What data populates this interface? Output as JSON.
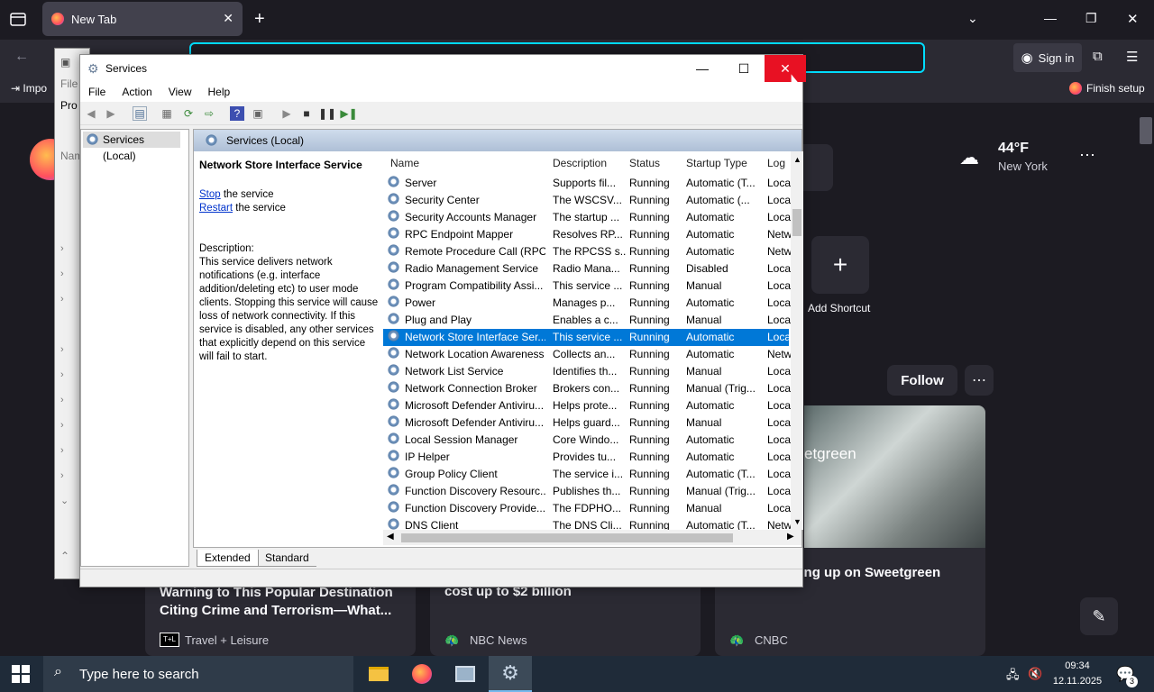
{
  "browser": {
    "tab_title": "New Tab",
    "bookmarks_import": "Impo",
    "sign_in": "Sign in",
    "finish_setup": "Finish setup",
    "weather": {
      "temp": "44°F",
      "city": "New York"
    },
    "shortcut_label": "Add Shortcut",
    "follow_label": "Follow",
    "news": [
      {
        "headline": "Warning to This Popular Destination Citing Crime and Terrorism—What...",
        "source": "Travel + Leisure"
      },
      {
        "headline": "cost up to $2 billion",
        "source": "NBC News"
      },
      {
        "headline": "ans are giving up on Sweetgreen",
        "source": "CNBC"
      }
    ],
    "photo_sign": "etgreen"
  },
  "back_window": {
    "menu_file": "File",
    "menu_pro": "Pro",
    "label_nam": "Nam"
  },
  "services": {
    "title": "Services",
    "menu": [
      "File",
      "Action",
      "View",
      "Help"
    ],
    "tree_item": "Services (Local)",
    "pane_title": "Services (Local)",
    "selected_name": "Network Store Interface Service",
    "stop_link": "Stop",
    "stop_rest": " the service",
    "restart_link": "Restart",
    "restart_rest": " the service",
    "desc_label": "Description:",
    "desc_text": "This service delivers network notifications (e.g. interface addition/deleting etc) to user mode clients. Stopping this service will cause loss of network connectivity. If this service is disabled, any other services that explicitly depend on this service will fail to start.",
    "columns": [
      "Name",
      "Description",
      "Status",
      "Startup Type",
      "Log"
    ],
    "rows": [
      [
        "Server",
        "Supports fil...",
        "Running",
        "Automatic (T...",
        "Loca"
      ],
      [
        "Security Center",
        "The WSCSV...",
        "Running",
        "Automatic (...",
        "Loca"
      ],
      [
        "Security Accounts Manager",
        "The startup ...",
        "Running",
        "Automatic",
        "Loca"
      ],
      [
        "RPC Endpoint Mapper",
        "Resolves RP...",
        "Running",
        "Automatic",
        "Netw"
      ],
      [
        "Remote Procedure Call (RPC)",
        "The RPCSS s...",
        "Running",
        "Automatic",
        "Netw"
      ],
      [
        "Radio Management Service",
        "Radio Mana...",
        "Running",
        "Disabled",
        "Loca"
      ],
      [
        "Program Compatibility Assi...",
        "This service ...",
        "Running",
        "Manual",
        "Loca"
      ],
      [
        "Power",
        "Manages p...",
        "Running",
        "Automatic",
        "Loca"
      ],
      [
        "Plug and Play",
        "Enables a c...",
        "Running",
        "Manual",
        "Loca"
      ],
      [
        "Network Store Interface Ser...",
        "This service ...",
        "Running",
        "Automatic",
        "Loca"
      ],
      [
        "Network Location Awareness",
        "Collects an...",
        "Running",
        "Automatic",
        "Netw"
      ],
      [
        "Network List Service",
        "Identifies th...",
        "Running",
        "Manual",
        "Loca"
      ],
      [
        "Network Connection Broker",
        "Brokers con...",
        "Running",
        "Manual (Trig...",
        "Loca"
      ],
      [
        "Microsoft Defender Antiviru...",
        "Helps prote...",
        "Running",
        "Automatic",
        "Loca"
      ],
      [
        "Microsoft Defender Antiviru...",
        "Helps guard...",
        "Running",
        "Manual",
        "Loca"
      ],
      [
        "Local Session Manager",
        "Core Windo...",
        "Running",
        "Automatic",
        "Loca"
      ],
      [
        "IP Helper",
        "Provides tu...",
        "Running",
        "Automatic",
        "Loca"
      ],
      [
        "Group Policy Client",
        "The service i...",
        "Running",
        "Automatic (T...",
        "Loca"
      ],
      [
        "Function Discovery Resourc...",
        "Publishes th...",
        "Running",
        "Manual (Trig...",
        "Loca"
      ],
      [
        "Function Discovery Provide...",
        "The FDPHO...",
        "Running",
        "Manual",
        "Loca"
      ],
      [
        "DNS Client",
        "The DNS Cli...",
        "Running",
        "Automatic (T...",
        "Netw"
      ]
    ],
    "selected_index": 9,
    "tab_extended": "Extended",
    "tab_standard": "Standard"
  },
  "taskbar": {
    "search_placeholder": "Type here to search",
    "time": "09:34",
    "date": "12.11.2025",
    "notif_count": "3"
  }
}
